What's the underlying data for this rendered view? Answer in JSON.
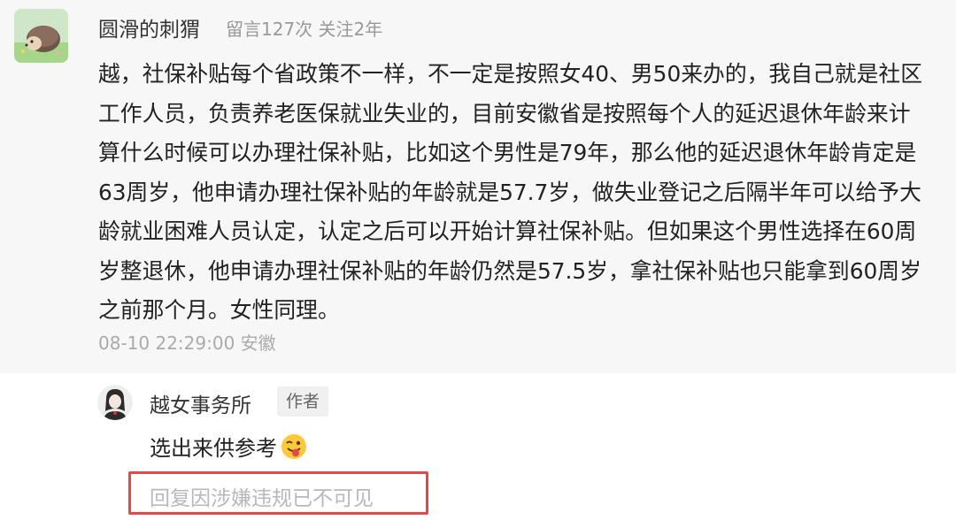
{
  "comment": {
    "username": "圆滑的刺猬",
    "meta": "留言127次 关注2年",
    "lines": [
      "越，社保补贴每个省政策不一样，不一定是按照女40、男50来办的，我自己就是社区",
      "工作人员，负责养老医保就业失业的，目前安徽省是按照每个人的延迟退休年龄来计",
      "算什么时候可以办理社保补贴，比如这个男性是79年，那么他的延迟退休年龄肯定是",
      "63周岁，他申请办理社保补贴的年龄就是57.7岁，做失业登记之后隔半年可以给予大",
      "龄就业困难人员认定，认定之后可以开始计算社保补贴。但如果这个男性选择在60周",
      "岁整退休，他申请办理社保补贴的年龄仍然是57.5岁，拿社保补贴也只能拿到60周岁",
      "之前那个月。女性同理。"
    ],
    "timestamp": "08-10 22:29:00 安徽"
  },
  "reply": {
    "username": "越女事务所",
    "badge": "作者",
    "text": "选出来供参考",
    "emoji_icon": "winking-tongue-emoji-icon",
    "hidden_text": "回复因涉嫌违规已不可见"
  },
  "colors": {
    "highlight_border": "#e8474a",
    "card_background": "#f7f7f7"
  }
}
